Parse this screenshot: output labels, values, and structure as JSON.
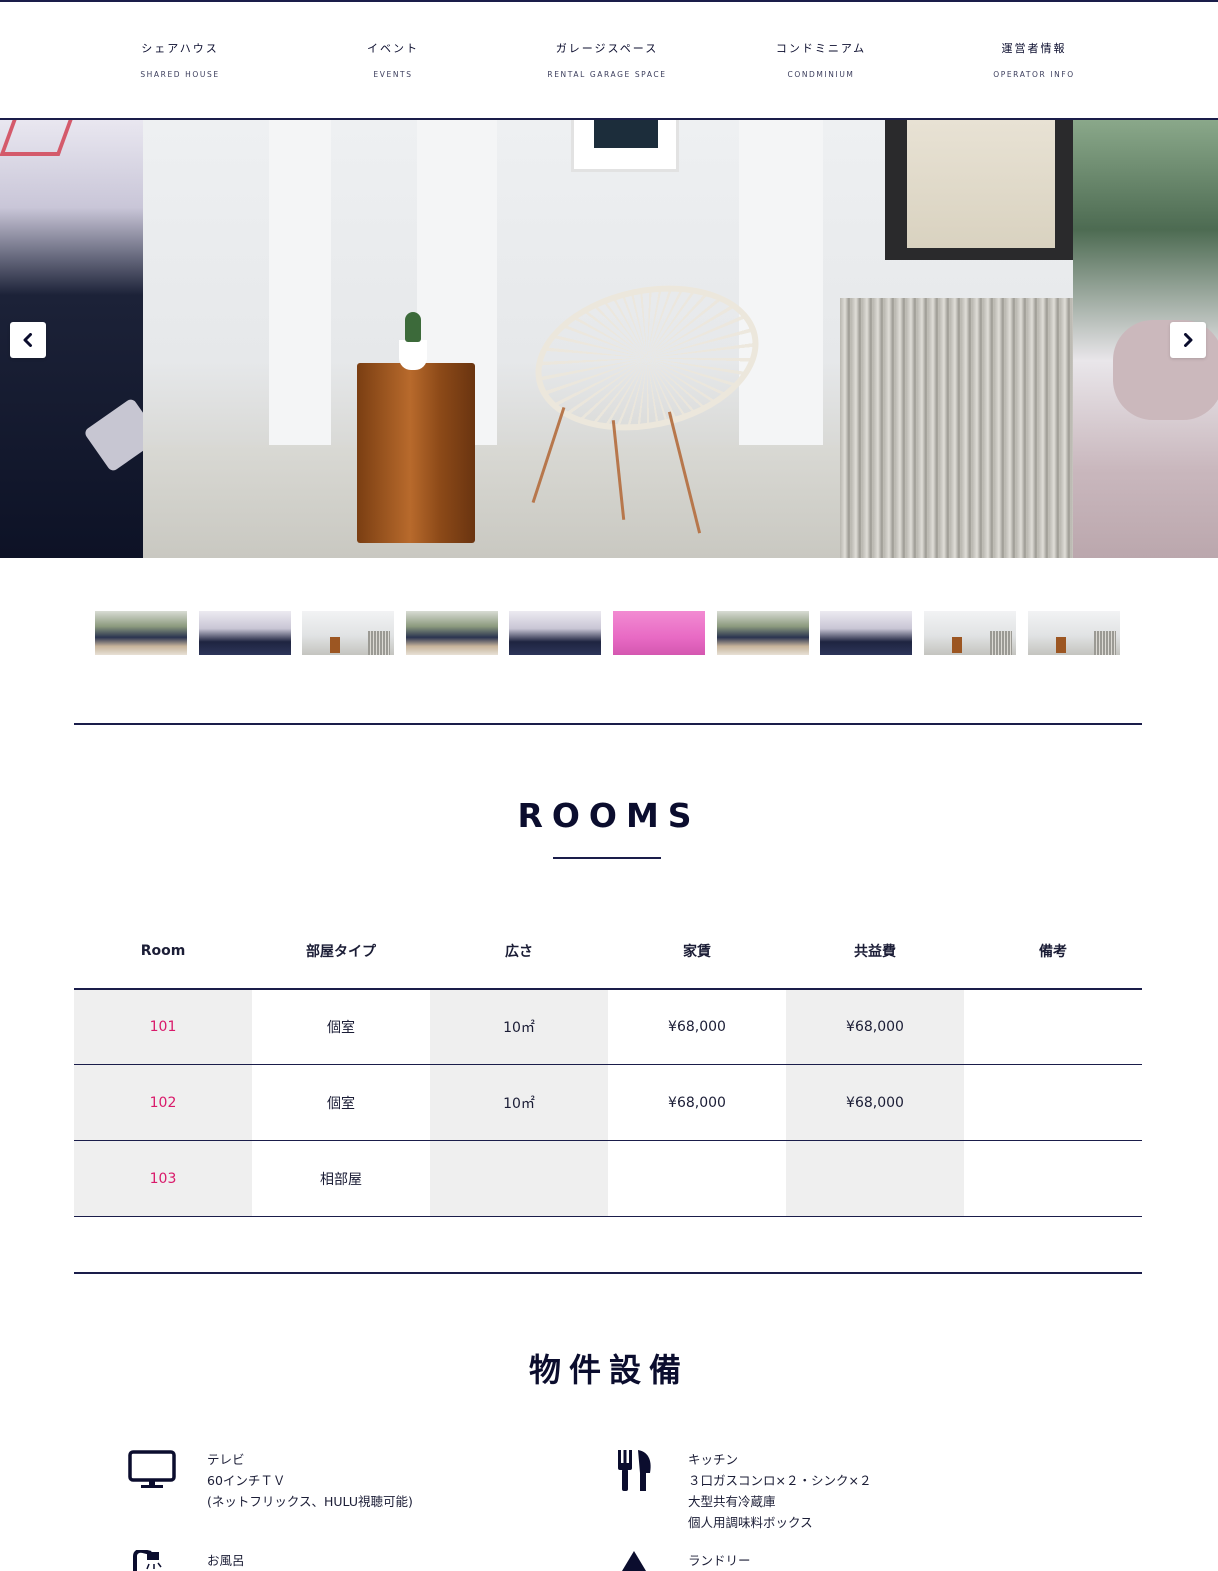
{
  "nav": {
    "items": [
      {
        "jp": "シェアハウス",
        "en": "SHARED HOUSE"
      },
      {
        "jp": "イベント",
        "en": "EVENTS"
      },
      {
        "jp": "ガレージスペース",
        "en": "RENTAL GARAGE SPACE"
      },
      {
        "jp": "コンドミニアム",
        "en": "CONDMINIUM"
      },
      {
        "jp": "運営者情報",
        "en": "OPERATOR INFO"
      }
    ]
  },
  "slider": {
    "prev_icon": "chevron-left-icon",
    "next_icon": "chevron-right-icon"
  },
  "rooms": {
    "title": "ROOMS",
    "headers": [
      "Room",
      "部屋タイプ",
      "広さ",
      "家賃",
      "共益費",
      "備考"
    ],
    "rows": [
      [
        "101",
        "個室",
        "10㎡",
        "¥68,000",
        "¥68,000",
        ""
      ],
      [
        "102",
        "個室",
        "10㎡",
        "¥68,000",
        "¥68,000",
        ""
      ],
      [
        "103",
        "相部屋",
        "",
        "",
        "",
        ""
      ]
    ]
  },
  "equipment": {
    "title": "物件設備",
    "items": [
      {
        "icon": "tv-icon",
        "name": "テレビ",
        "lines": [
          "60インチＴＶ",
          "(ネットフリックス、HULU視聴可能)"
        ]
      },
      {
        "icon": "cutlery-icon",
        "name": "キッチン",
        "lines": [
          "３口ガスコンロ×２・シンク×２",
          "大型共有冷蔵庫",
          "個人用調味料ボックス"
        ]
      },
      {
        "icon": "shower-icon",
        "name": "お風呂",
        "lines": []
      },
      {
        "icon": "laundry-icon",
        "name": "ランドリー",
        "lines": []
      }
    ]
  },
  "colors": {
    "navy": "#0b0d2e",
    "accent": "#d9196a",
    "shade": "#efefef"
  }
}
